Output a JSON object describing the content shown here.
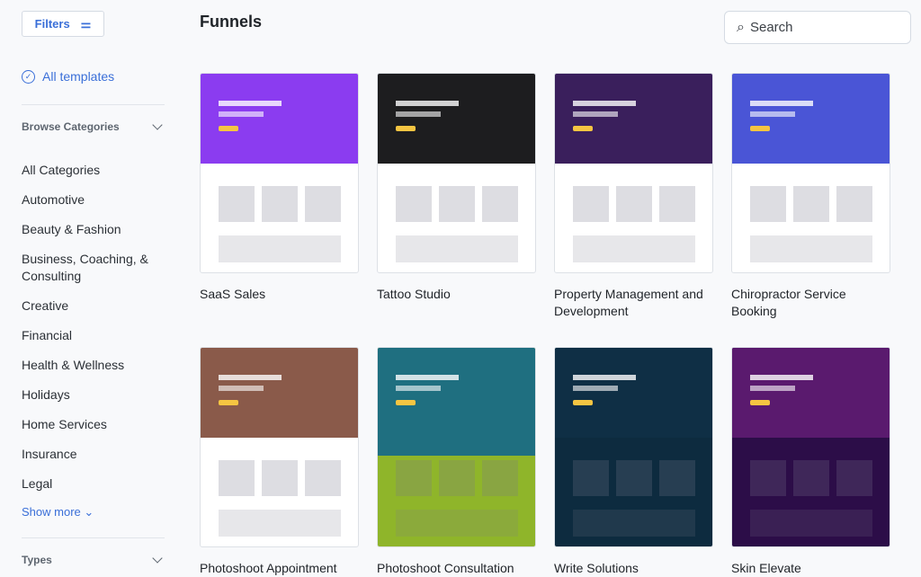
{
  "sidebar": {
    "filters_label": "Filters",
    "all_templates": "All templates",
    "browse_categories": "Browse Categories",
    "categories": [
      "All Categories",
      "Automotive",
      "Beauty & Fashion",
      "Business, Coaching, & Consulting",
      "Creative",
      "Financial",
      "Health & Wellness",
      "Holidays",
      "Home Services",
      "Insurance",
      "Legal"
    ],
    "show_more": "Show more",
    "types": "Types"
  },
  "header": {
    "title": "Funnels",
    "search_placeholder": "Search"
  },
  "templates": [
    {
      "name": "SaaS Sales",
      "hero": "#8b3cf0",
      "body": "#ffffff"
    },
    {
      "name": "Tattoo Studio",
      "hero": "#1d1d1f",
      "body": "#ffffff"
    },
    {
      "name": "Property Management and Development",
      "hero": "#3a1f5c",
      "body": "#ffffff"
    },
    {
      "name": "Chiropractor Service Booking",
      "hero": "#4a55d6",
      "body": "#ffffff"
    },
    {
      "name": "Photoshoot Appointment",
      "hero": "#8a5a4a",
      "body": "#ffffff"
    },
    {
      "name": "Photoshoot Consultation",
      "hero": "#1f6f80",
      "body": "#8fb52a"
    },
    {
      "name": "Write Solutions",
      "hero": "#0f2f45",
      "body": "#0d2b3f"
    },
    {
      "name": "Skin Elevate",
      "hero": "#5a1a6e",
      "body": "#2c0d48"
    }
  ]
}
